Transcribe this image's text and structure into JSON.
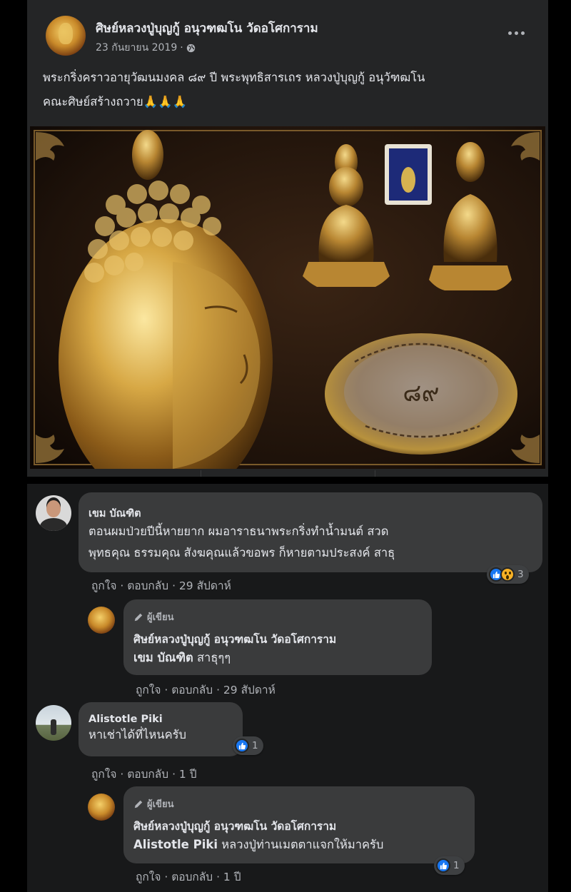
{
  "post": {
    "page_name": "ศิษย์หลวงปู่บุญกู้ อนุวฑฒโน วัดอโศการาม",
    "date": "23 กันยายน 2019",
    "date_separator": "·",
    "privacy_icon": "globe-icon",
    "more_icon": "more-options-icon",
    "text_line1": "พระกริ่งคราวอายุวัฒนมงคล ๘๙ ปี พระพุทธิสารเถร หลวงปู่บุญกู้ อนุวัฑฒโน",
    "text_line2": "คณะศิษย์สร้างถวาย",
    "text_emoji": "🙏🙏🙏",
    "photo_inscription": "๘๙",
    "colors": {
      "card": "#242526",
      "text": "#e4e6eb",
      "secondary": "#b0b3b8",
      "gold": "#c99a35"
    }
  },
  "comments": [
    {
      "name": "เขม บัณฑิต",
      "line1": "ตอนผมป่วยปีนี้หายยาก ผมอาราธนาพระกริ่งทำน้ำมนต์ สวด",
      "line2": "พุทธคุณ ธรรมคุณ สังฆคุณแล้วขอพร ก็หายตามประสงค์ สาธุ",
      "reactions": {
        "icons": [
          "like-icon",
          "wow-icon"
        ],
        "count": "3"
      },
      "actions": {
        "like": "ถูกใจ",
        "sep": " · ",
        "reply": "ตอบกลับ",
        "time": "29 สัปดาห์"
      },
      "reply": {
        "badge": "ผู้เขียน",
        "name": "ศิษย์หลวงปู่บุญกู้ อนุวฑฒโน วัดอโศการาม",
        "mention": "เขม บัณฑิต",
        "text": "สาธุๆๆ",
        "actions": {
          "like": "ถูกใจ",
          "sep": " · ",
          "reply": "ตอบกลับ",
          "time": "29 สัปดาห์"
        }
      }
    },
    {
      "name": "Alistotle Piki",
      "line1": "หาเช่าได้ที่ไหนครับ",
      "reactions": {
        "icons": [
          "like-icon"
        ],
        "count": "1"
      },
      "actions": {
        "like": "ถูกใจ",
        "sep": " · ",
        "reply": "ตอบกลับ",
        "time": "1 ปี"
      },
      "reply": {
        "badge": "ผู้เขียน",
        "name": "ศิษย์หลวงปู่บุญกู้ อนุวฑฒโน วัดอโศการาม",
        "mention": "Alistotle Piki",
        "text": "หลวงปู่ท่านเมตตาแจกให้มาครับ",
        "reactions": {
          "icons": [
            "like-icon"
          ],
          "count": "1"
        },
        "actions": {
          "like": "ถูกใจ",
          "sep": " · ",
          "reply": "ตอบกลับ",
          "time": "1 ปี"
        }
      }
    }
  ]
}
